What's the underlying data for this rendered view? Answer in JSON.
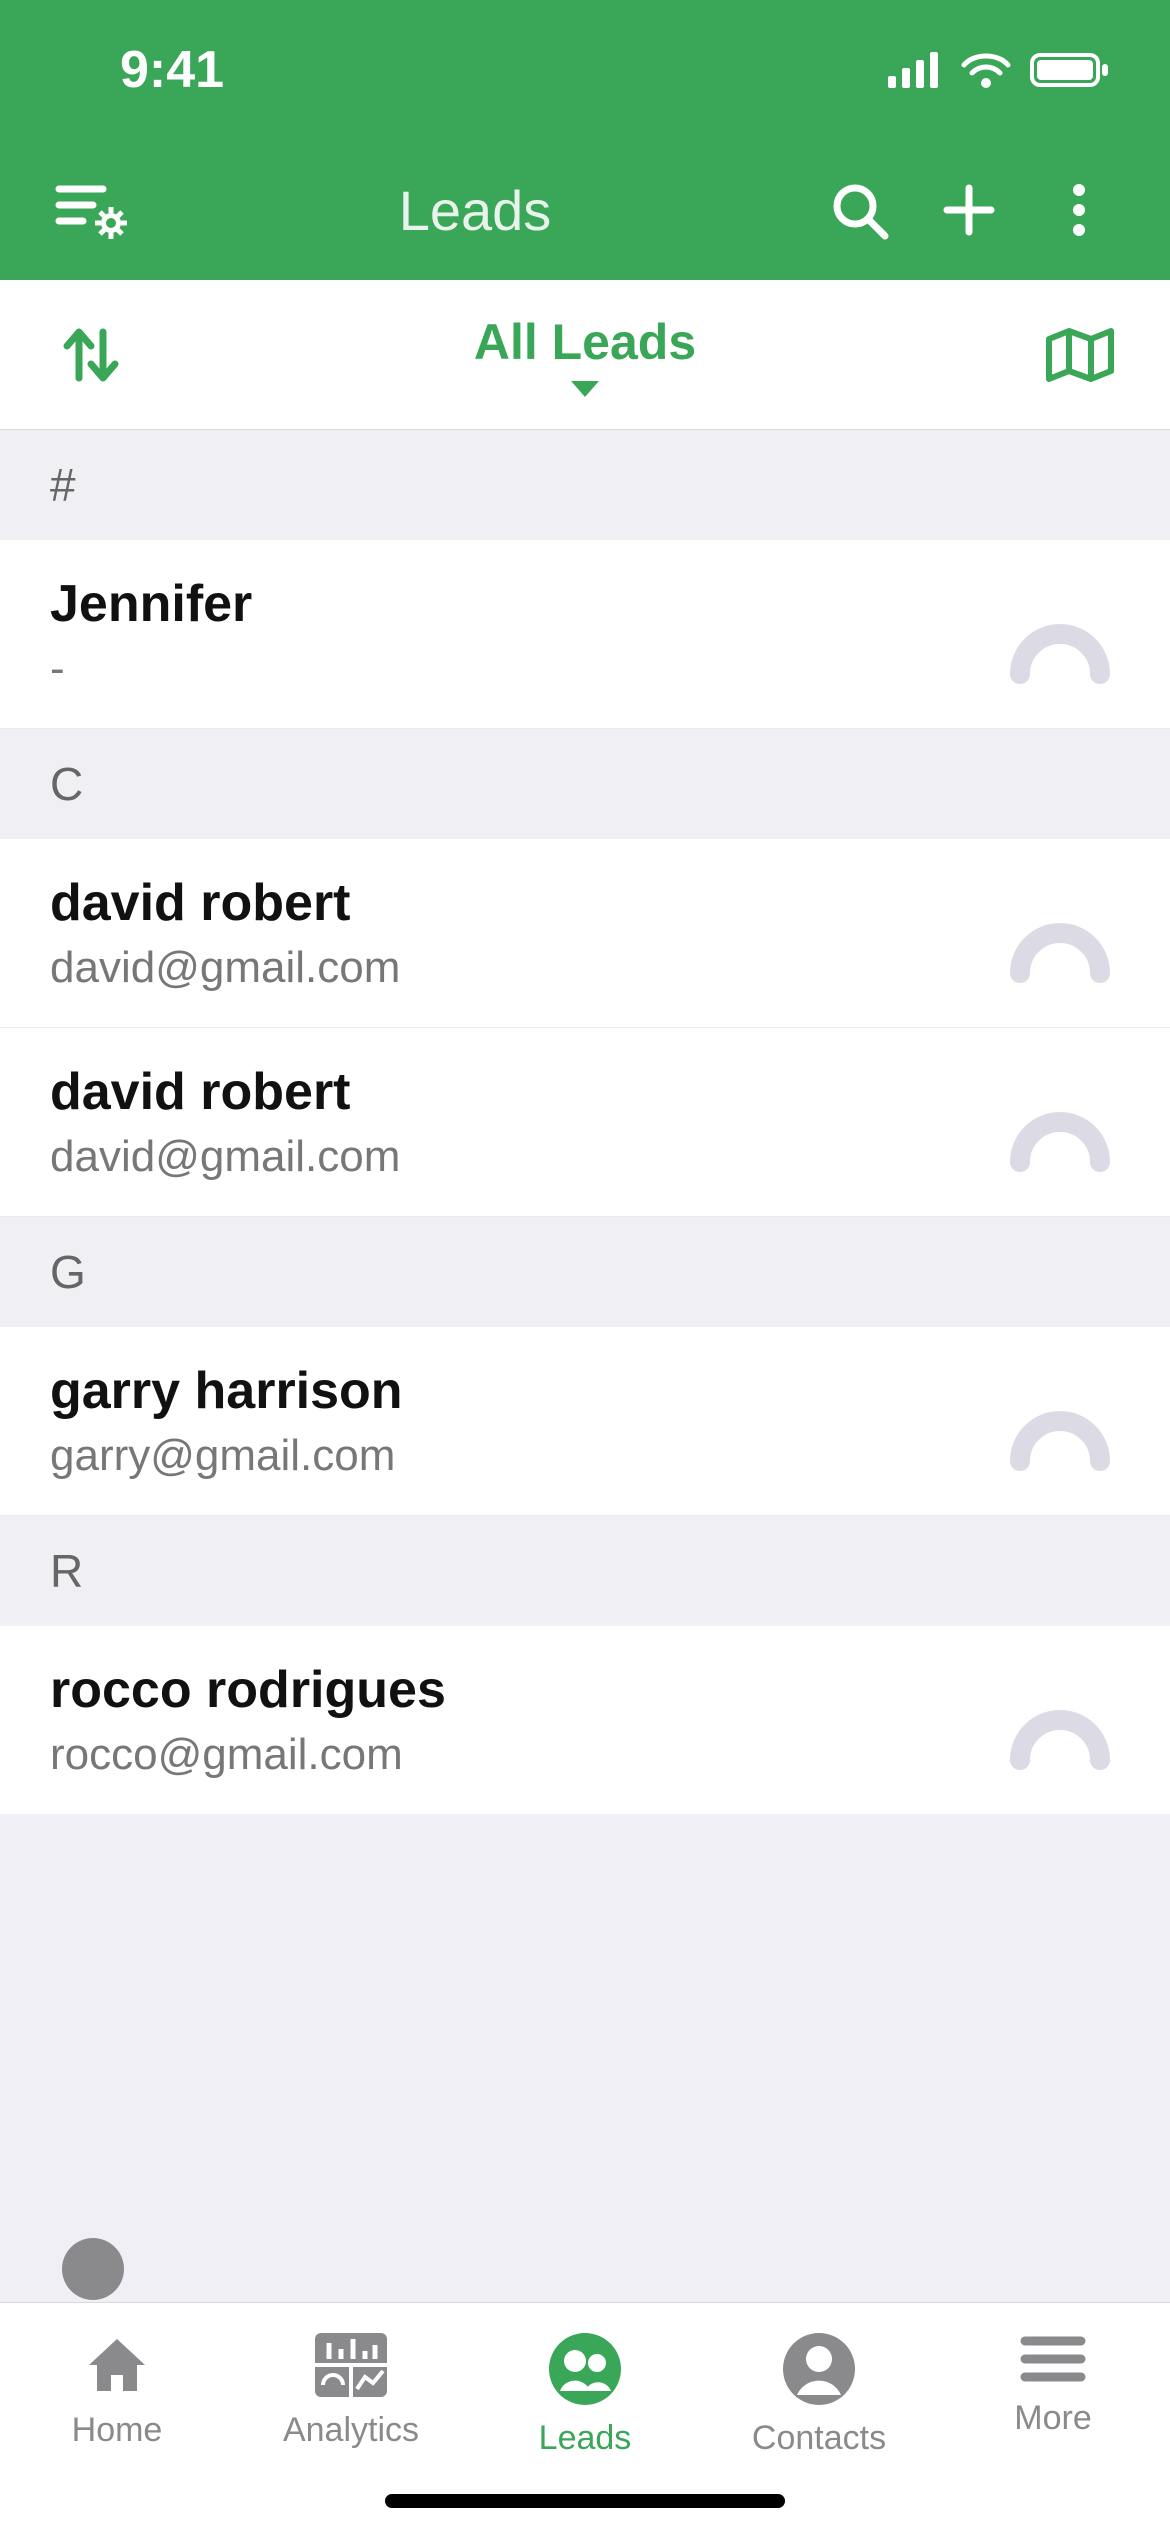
{
  "status": {
    "time": "9:41"
  },
  "header": {
    "title": "Leads"
  },
  "filter": {
    "label": "All Leads"
  },
  "sections": [
    {
      "header": "#",
      "items": [
        {
          "name": "Jennifer",
          "sub": "-"
        }
      ]
    },
    {
      "header": "C",
      "items": [
        {
          "name": "david robert",
          "sub": "david@gmail.com"
        },
        {
          "name": "david robert",
          "sub": "david@gmail.com"
        }
      ]
    },
    {
      "header": "G",
      "items": [
        {
          "name": "garry harrison",
          "sub": "garry@gmail.com"
        }
      ]
    },
    {
      "header": "R",
      "items": [
        {
          "name": "rocco rodrigues",
          "sub": "rocco@gmail.com"
        }
      ]
    }
  ],
  "nav": {
    "items": [
      {
        "label": "Home"
      },
      {
        "label": "Analytics"
      },
      {
        "label": "Leads"
      },
      {
        "label": "Contacts"
      },
      {
        "label": "More"
      }
    ],
    "active_index": 2
  }
}
